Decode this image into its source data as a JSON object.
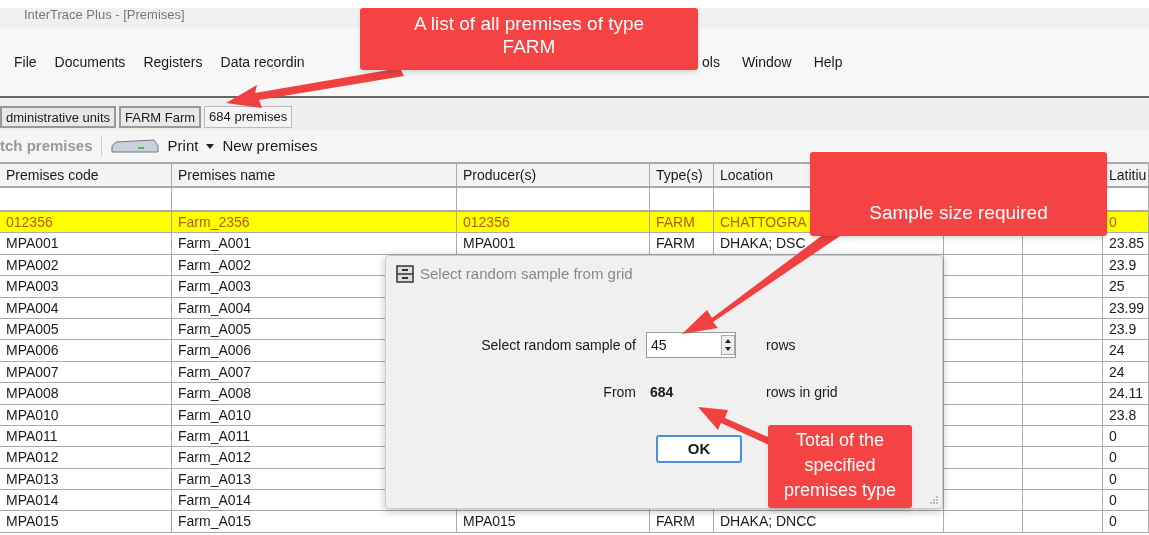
{
  "window": {
    "title": "InterTrace Plus - [Premises]"
  },
  "menu": [
    "File",
    "Documents",
    "Registers",
    "Data recordin",
    "ols",
    "Window",
    "Help"
  ],
  "tabs": [
    {
      "label": "dministrative units",
      "selected": false
    },
    {
      "label": "FARM Farm",
      "selected": false
    },
    {
      "label": "684 premises",
      "selected": true
    }
  ],
  "toolbar": {
    "fetch": {
      "label": "tch premises",
      "disabled": true
    },
    "print": "Print",
    "new": "New premises"
  },
  "table": {
    "columns": [
      "Premises code",
      "Premises name",
      "Producer(s)",
      "Type(s)",
      "Location",
      "",
      "",
      "Latitiu"
    ],
    "rows": [
      {
        "code": "012356",
        "name": "Farm_2356",
        "producer": "012356",
        "type": "FARM",
        "location": "CHATTOGRA",
        "latitude": "0",
        "selected": true
      },
      {
        "code": "MPA001",
        "name": "Farm_A001",
        "producer": "MPA001",
        "type": "FARM",
        "location": "DHAKA; DSC",
        "latitude": "23.85",
        "selected": false
      },
      {
        "code": "MPA002",
        "name": "Farm_A002",
        "latitude": "23.9",
        "selected": false
      },
      {
        "code": "MPA003",
        "name": "Farm_A003",
        "latitude": "25",
        "selected": false
      },
      {
        "code": "MPA004",
        "name": "Farm_A004",
        "latitude": "23.99",
        "selected": false
      },
      {
        "code": "MPA005",
        "name": "Farm_A005",
        "latitude": "23.9",
        "selected": false
      },
      {
        "code": "MPA006",
        "name": "Farm_A006",
        "latitude": "24",
        "selected": false
      },
      {
        "code": "MPA007",
        "name": "Farm_A007",
        "latitude": "24",
        "selected": false
      },
      {
        "code": "MPA008",
        "name": "Farm_A008",
        "latitude": "24.11",
        "selected": false
      },
      {
        "code": "MPA010",
        "name": "Farm_A010",
        "latitude": "23.8",
        "selected": false
      },
      {
        "code": "MPA011",
        "name": "Farm_A011",
        "latitude": "0",
        "selected": false
      },
      {
        "code": "MPA012",
        "name": "Farm_A012",
        "latitude": "0",
        "selected": false
      },
      {
        "code": "MPA013",
        "name": "Farm_A013",
        "latitude": "0",
        "selected": false
      },
      {
        "code": "MPA014",
        "name": "Farm_A014",
        "latitude": "0",
        "selected": false
      },
      {
        "code": "MPA015",
        "name": "Farm_A015",
        "producer": "MPA015",
        "type": "FARM",
        "location": "DHAKA; DNCC",
        "latitude": "0",
        "selected": false
      }
    ]
  },
  "dialog": {
    "title": "Select random sample from grid",
    "sample_label": "Select random sample of",
    "sample_value": "45",
    "sample_unit": "rows",
    "from_label": "From",
    "from_value": "684",
    "from_unit": "rows in grid",
    "ok": "OK"
  },
  "callouts": [
    "A list of all premises of type FARM",
    "Sample size required",
    "Total of the specified premises type"
  ]
}
